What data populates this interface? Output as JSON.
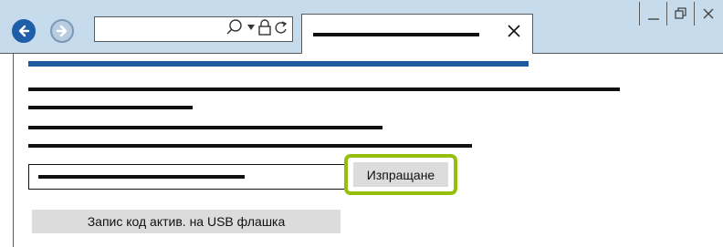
{
  "browser": {
    "nav": {
      "back_icon": "arrow-left-icon",
      "forward_icon": "arrow-right-icon"
    },
    "address_bar": {
      "value": "",
      "icons": [
        "search-icon",
        "dropdown-icon",
        "lock-icon",
        "refresh-icon"
      ]
    },
    "tab": {
      "title": "",
      "close_icon": "close-icon"
    },
    "window_controls": [
      "minimize-icon",
      "restore-icon",
      "close-icon"
    ],
    "colors": {
      "chrome": "#c6dced",
      "back_button": "#1f5ea8",
      "forward_button": "#b9cde2"
    }
  },
  "page": {
    "header_bar_color": "#1e5aa0",
    "placeholder_text_lines": 4,
    "url_field": {
      "value": ""
    },
    "send_button": {
      "label": "Изпращане"
    },
    "highlight_color": "#97be0d",
    "usb_button": {
      "label": "Запис код актив. на USB флашка"
    }
  }
}
